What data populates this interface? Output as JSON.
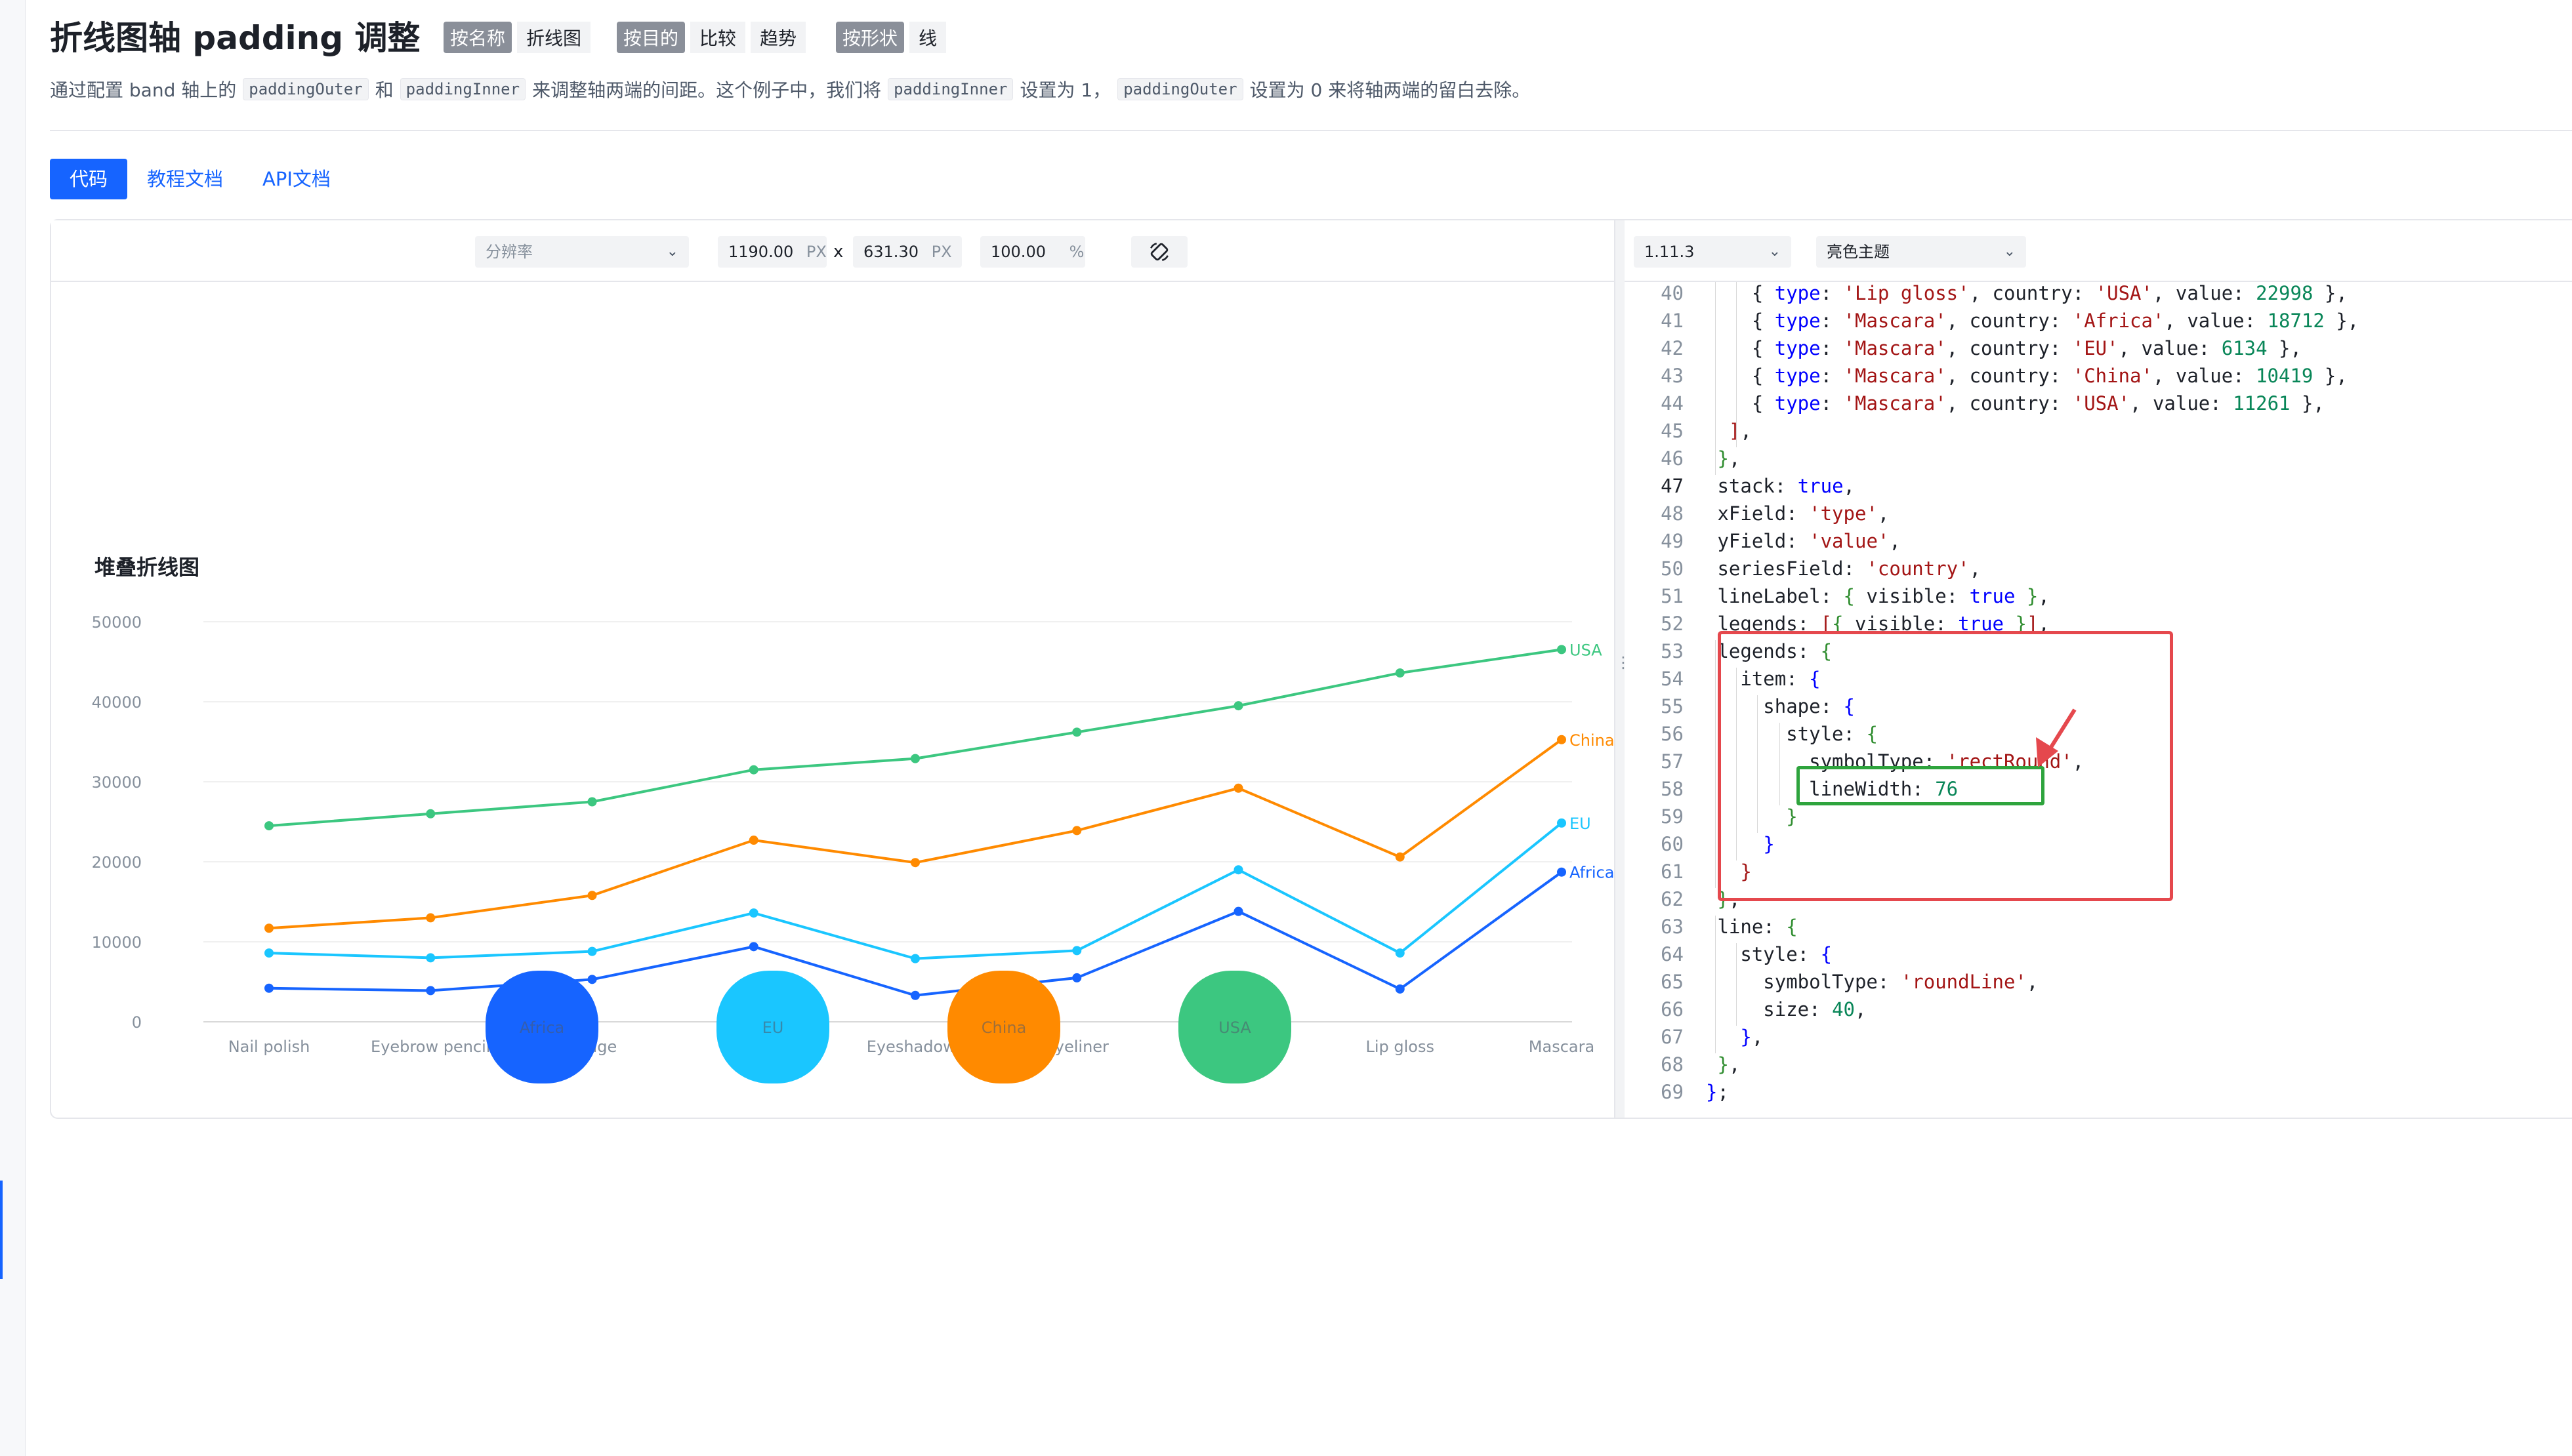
{
  "page": {
    "title": "折线图轴 padding 调整",
    "tags": [
      {
        "key": "按名称",
        "values": [
          "折线图"
        ]
      },
      {
        "key": "按目的",
        "values": [
          "比较",
          "趋势"
        ]
      },
      {
        "key": "按形状",
        "values": [
          "线"
        ]
      }
    ],
    "description": {
      "t1": "通过配置 band 轴上的",
      "c1": "paddingOuter",
      "t2": "和",
      "c2": "paddingInner",
      "t3": "来调整轴两端的间距。这个例子中，我们将",
      "c3": "paddingInner",
      "t4": "设置为 1，",
      "c4": "paddingOuter",
      "t5": "设置为 0 来将轴两端的留白去除。"
    }
  },
  "tabs": [
    "代码",
    "教程文档",
    "API文档"
  ],
  "toolbar": {
    "resolution_placeholder": "分辨率",
    "width": "1190.00",
    "width_unit": "PX",
    "times": "x",
    "height": "631.30",
    "height_unit": "PX",
    "zoom": "100.00",
    "zoom_unit": "%"
  },
  "editor": {
    "version": "1.11.3",
    "theme": "亮色主题"
  },
  "colors": {
    "accent": "#1664ff",
    "Africa": "#1664ff",
    "EU": "#1ac6ff",
    "China": "#ff8a00",
    "USA": "#3cc780",
    "annotation_red": "#e5484d",
    "annotation_green": "#2ea43d"
  },
  "chart_data": {
    "type": "line",
    "title": "堆叠折线图",
    "categories": [
      "Nail polish",
      "Eyebrow pencil",
      "Rouge",
      "Lipstick",
      "Eyeshadows",
      "Eyeliner",
      "Foundation",
      "Lip gloss",
      "Mascara"
    ],
    "yticks": [
      "0",
      "10000",
      "20000",
      "30000",
      "40000",
      "50000"
    ],
    "ylim": [
      0,
      50000
    ],
    "stacked": true,
    "series": [
      {
        "name": "Africa",
        "values": [
          4200,
          3900,
          5300,
          9400,
          3300,
          5500,
          13800,
          4100,
          18712
        ]
      },
      {
        "name": "EU",
        "values": [
          8600,
          8000,
          8800,
          13600,
          7900,
          8900,
          19000,
          8600,
          24846
        ]
      },
      {
        "name": "China",
        "values": [
          11700,
          13000,
          15800,
          22700,
          19900,
          23900,
          29200,
          20600,
          35265
        ]
      },
      {
        "name": "USA",
        "values": [
          24500,
          26000,
          27500,
          31500,
          32900,
          36200,
          39500,
          43600,
          46526
        ]
      }
    ],
    "legend": {
      "shape": "rectRound",
      "position": "bottom",
      "labels": [
        "Africa",
        "EU",
        "China",
        "USA"
      ]
    }
  },
  "code_lines": [
    {
      "n": "40",
      "html": "    { <span class=\"k\">type</span>: <span class=\"s\">'Lip gloss'</span>, country: <span class=\"s\">'USA'</span>, value: <span class=\"n\">22998</span> },"
    },
    {
      "n": "41",
      "html": "    { <span class=\"k\">type</span>: <span class=\"s\">'Mascara'</span>, country: <span class=\"s\">'Africa'</span>, value: <span class=\"n\">18712</span> },"
    },
    {
      "n": "42",
      "html": "    { <span class=\"k\">type</span>: <span class=\"s\">'Mascara'</span>, country: <span class=\"s\">'EU'</span>, value: <span class=\"n\">6134</span> },"
    },
    {
      "n": "43",
      "html": "    { <span class=\"k\">type</span>: <span class=\"s\">'Mascara'</span>, country: <span class=\"s\">'China'</span>, value: <span class=\"n\">10419</span> },"
    },
    {
      "n": "44",
      "html": "    { <span class=\"k\">type</span>: <span class=\"s\">'Mascara'</span>, country: <span class=\"s\">'USA'</span>, value: <span class=\"n\">11261</span> },"
    },
    {
      "n": "45",
      "html": "  <span class=\"s\">]</span>,"
    },
    {
      "n": "46",
      "html": " <span class=\"p\">}</span>,"
    },
    {
      "n": "47",
      "html": " stack: <span class=\"k\">true</span>,"
    },
    {
      "n": "48",
      "html": " xField: <span class=\"s\">'type'</span>,"
    },
    {
      "n": "49",
      "html": " yField: <span class=\"s\">'value'</span>,"
    },
    {
      "n": "50",
      "html": " seriesField: <span class=\"s\">'country'</span>,"
    },
    {
      "n": "51",
      "html": " lineLabel: <span class=\"p\">{</span> visible: <span class=\"k\">true</span> <span class=\"p\">}</span>,"
    },
    {
      "n": "52",
      "html": " legends: <span class=\"s\">[</span><span class=\"p\">{</span> visible: <span class=\"k\">true</span> <span class=\"p\">}</span><span class=\"s\">]</span>,"
    },
    {
      "n": "53",
      "html": " legends: <span class=\"p\">{</span>"
    },
    {
      "n": "54",
      "html": "   item: <span class=\"k\">{</span>"
    },
    {
      "n": "55",
      "html": "     shape: <span class=\"k\">{</span>"
    },
    {
      "n": "56",
      "html": "       style: <span class=\"p\">{</span>"
    },
    {
      "n": "57",
      "html": "         symbolType: <span class=\"s\">'rectRound'</span>,"
    },
    {
      "n": "58",
      "html": "         lineWidth: <span class=\"n\">76</span>"
    },
    {
      "n": "59",
      "html": "       <span class=\"p\">}</span>"
    },
    {
      "n": "60",
      "html": "     <span class=\"k\">}</span>"
    },
    {
      "n": "61",
      "html": "   <span class=\"s\">}</span>"
    },
    {
      "n": "62",
      "html": " <span class=\"p\">}</span>,"
    },
    {
      "n": "63",
      "html": " line: <span class=\"p\">{</span>"
    },
    {
      "n": "64",
      "html": "   style: <span class=\"k\">{</span>"
    },
    {
      "n": "65",
      "html": "     symbolType: <span class=\"s\">'roundLine'</span>,"
    },
    {
      "n": "66",
      "html": "     size: <span class=\"n\">40</span>,"
    },
    {
      "n": "67",
      "html": "   <span class=\"k\">}</span>,"
    },
    {
      "n": "68",
      "html": " <span class=\"p\">}</span>,"
    },
    {
      "n": "69",
      "html": "<span class=\"k\">}</span>;"
    }
  ]
}
